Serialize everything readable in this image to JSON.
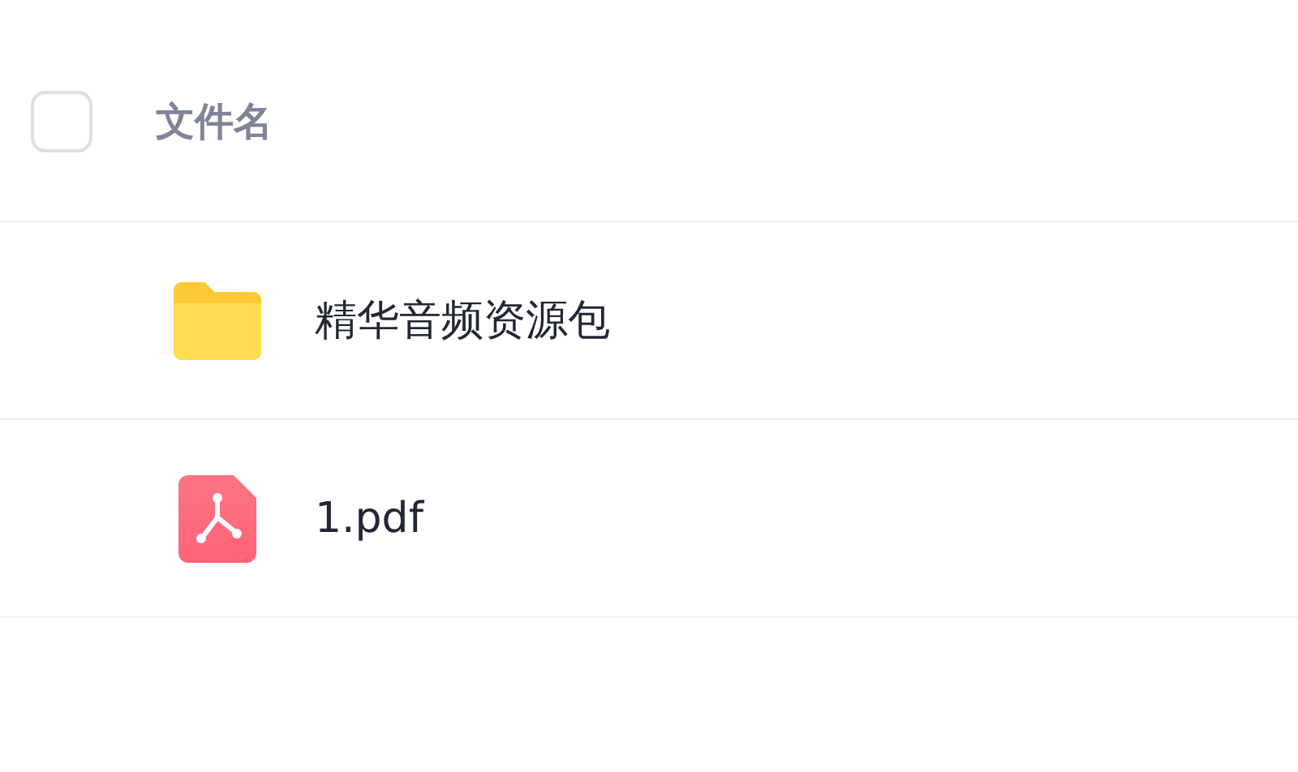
{
  "header": {
    "select_all": {
      "checked": false
    },
    "column_label": "文件名"
  },
  "files": [
    {
      "kind": "folder",
      "name": "精华音频资源包"
    },
    {
      "kind": "pdf",
      "name": "1.pdf"
    }
  ]
}
